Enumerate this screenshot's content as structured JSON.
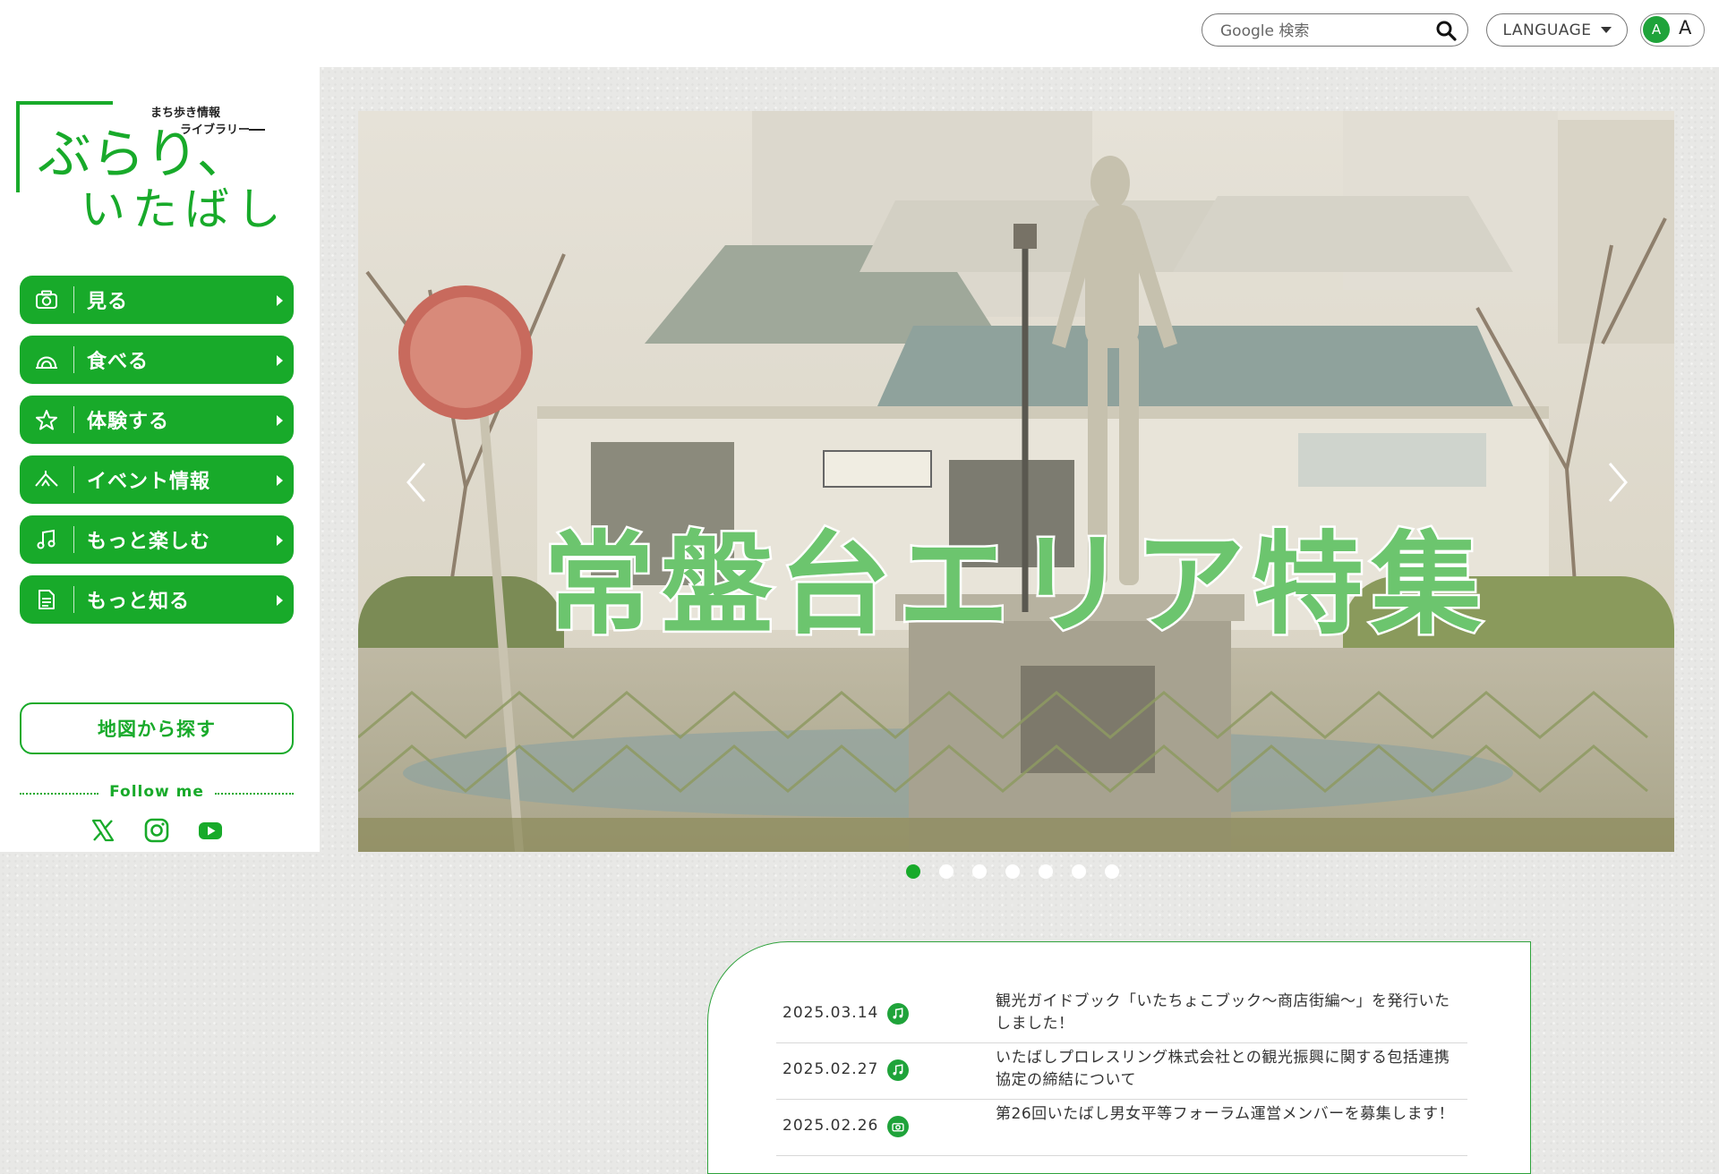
{
  "header": {
    "search_placeholder": "Google 検索",
    "language_label": "LANGUAGE",
    "font_small": "A",
    "font_large": "A"
  },
  "logo": {
    "tagline": [
      "まち歩き情報",
      "ライブラリー"
    ],
    "name_line1": "ぶらり、",
    "name_line2": "いたばし"
  },
  "menu": [
    {
      "label": "見る",
      "icon": "camera-icon"
    },
    {
      "label": "食べる",
      "icon": "dome-icon"
    },
    {
      "label": "体験する",
      "icon": "star-icon"
    },
    {
      "label": "イベント情報",
      "icon": "tent-icon"
    },
    {
      "label": "もっと楽しむ",
      "icon": "music-note-icon"
    },
    {
      "label": "もっと知る",
      "icon": "document-icon"
    }
  ],
  "map_button": "地図から探す",
  "follow_label": "Follow me",
  "social": [
    "x-icon",
    "instagram-icon",
    "youtube-icon"
  ],
  "hero": {
    "title": "常盤台エリア特集",
    "slide_count": 7,
    "active_slide": 1
  },
  "news": [
    {
      "date": "2025.03.14",
      "icon": "music-note-icon",
      "title": "観光ガイドブック「いたちょこブック〜商店街編〜」を発行いたしました！"
    },
    {
      "date": "2025.02.27",
      "icon": "music-note-icon",
      "title": "いたばしプロレスリング株式会社との観光振興に関する包括連携協定の締結について"
    },
    {
      "date": "2025.02.26",
      "icon": "camera-icon",
      "title": "第26回いたばし男女平等フォーラム運営メンバーを募集します！"
    }
  ],
  "colors": {
    "accent": "#18aa2a",
    "hero_title": "#6cc56e"
  }
}
